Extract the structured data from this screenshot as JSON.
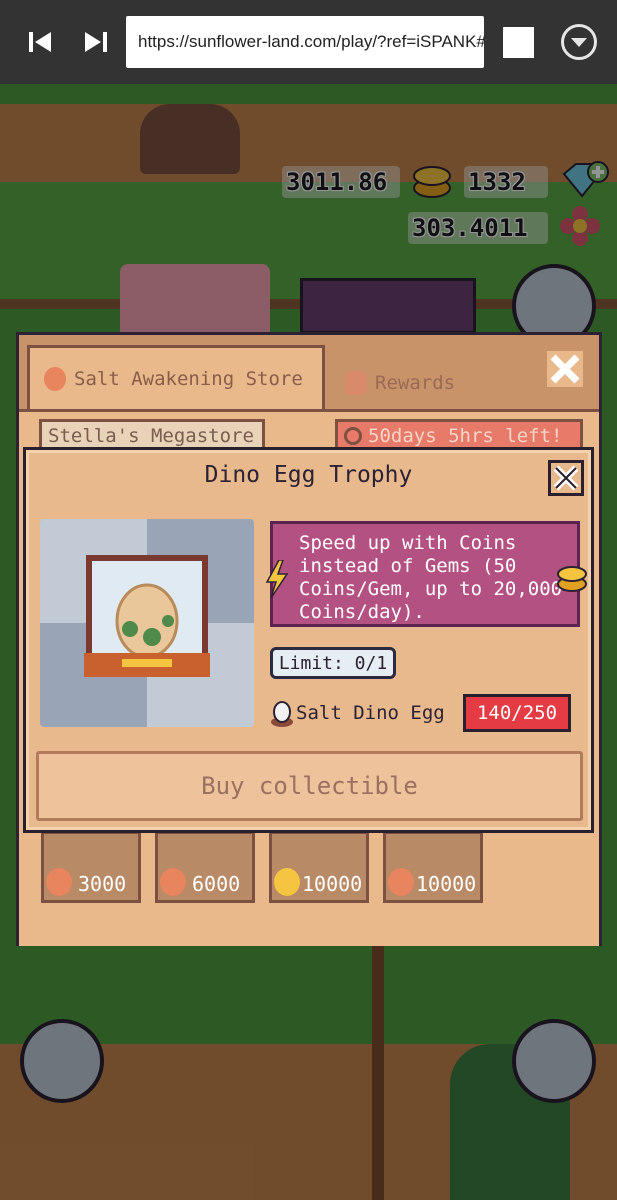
{
  "browser": {
    "url": "https://sunflower-land.com/play/?ref=iSPANK#"
  },
  "hud": {
    "coins": "3011.86",
    "gems": "1332",
    "flower": "303.4011"
  },
  "store": {
    "tabs": [
      {
        "label": "Salt Awakening Store",
        "icon": "salt-egg-icon"
      },
      {
        "label": "Rewards",
        "icon": "rewards-icon"
      }
    ],
    "shop_name": "Stella's Megastore",
    "time_left": "50days 5hrs left!",
    "prices": [
      "3000",
      "6000",
      "10000",
      "10000"
    ]
  },
  "modal": {
    "title": "Dino Egg Trophy",
    "speed_up_text": "Speed up with Coins instead of Gems (50 Coins/Gem, up to 20,000 Coins/day).",
    "limit": "Limit: 0/1",
    "ingredient_name": "Salt Dino Egg",
    "ingredient_count": "140/250",
    "buy_label": "Buy collectible"
  },
  "colors": {
    "panel": "#e8b98d",
    "speed_box": "#b35282",
    "count_badge": "#e43b44",
    "browser_bar": "#333333"
  }
}
